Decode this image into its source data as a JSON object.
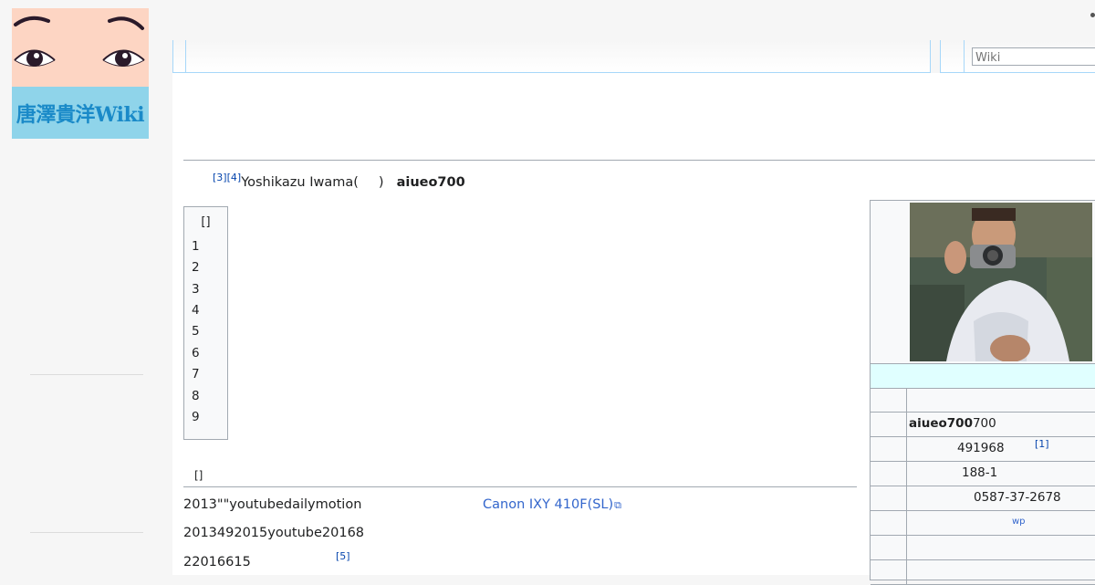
{
  "site": {
    "logo_text": "唐澤貴洋Wiki",
    "search_placeholder": "Wiki"
  },
  "article": {
    "lead": {
      "ref_a": "[3]",
      "ref_b": "[4]",
      "name": "Yoshikazu Iwama(",
      "close_paren": ")",
      "handle": "aiueo700"
    },
    "toc": {
      "title": "[]",
      "items": [
        "1",
        "2",
        "3",
        "4",
        "5",
        "6",
        "7",
        "8",
        "9"
      ]
    },
    "section": {
      "heading": "[]"
    },
    "paragraphs": {
      "line1": "2013\"\"youtubedailymotion",
      "line2": "2013492015youtube20168",
      "line3": "22016615",
      "ref5": "[5]",
      "camera_link": "Canon IXY 410F(SL)",
      "ext_icon": "⧉"
    }
  },
  "infobox": {
    "handle_bold": "aiueo700",
    "handle_rest": "700",
    "birth_year": "491968",
    "birth_ref": "[1]",
    "address": "188-1",
    "phone": "0587-37-2678",
    "wp": "wp"
  }
}
